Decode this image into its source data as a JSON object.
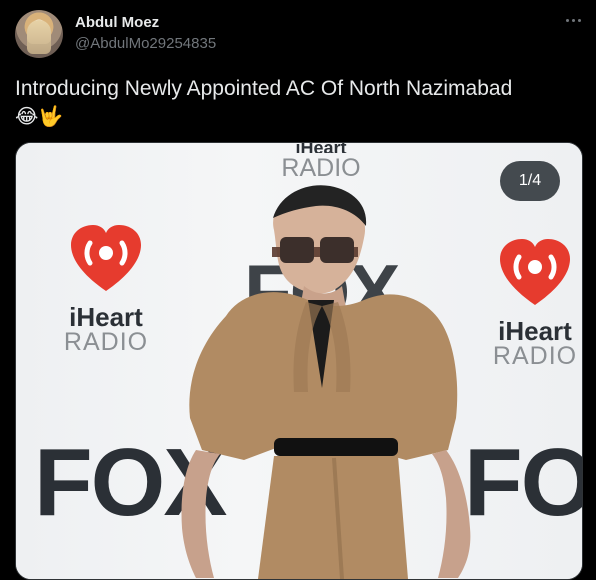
{
  "tweet": {
    "author_name": "Abdul Moez",
    "handle": "@AbdulMo29254835",
    "text": "Introducing Newly Appointed AC Of North Nazimabad",
    "emojis": "😂🤟"
  },
  "media": {
    "counter": "1/4",
    "backdrop": {
      "left_logo": {
        "line1": "iHeart",
        "line2": "RADIO"
      },
      "right_logo": {
        "line1": "iHeart",
        "line2": "RADIO"
      },
      "top_logo": {
        "line1": "iHeart",
        "line2": "RADIO"
      },
      "fox": "FOX"
    }
  },
  "icons": {
    "more": "more-horizontal-icon"
  },
  "colors": {
    "background": "#000000",
    "text_primary": "#e7e9ea",
    "text_secondary": "#71767b",
    "iheart_red": "#e63b2e",
    "backdrop_dark": "#2b3036"
  }
}
